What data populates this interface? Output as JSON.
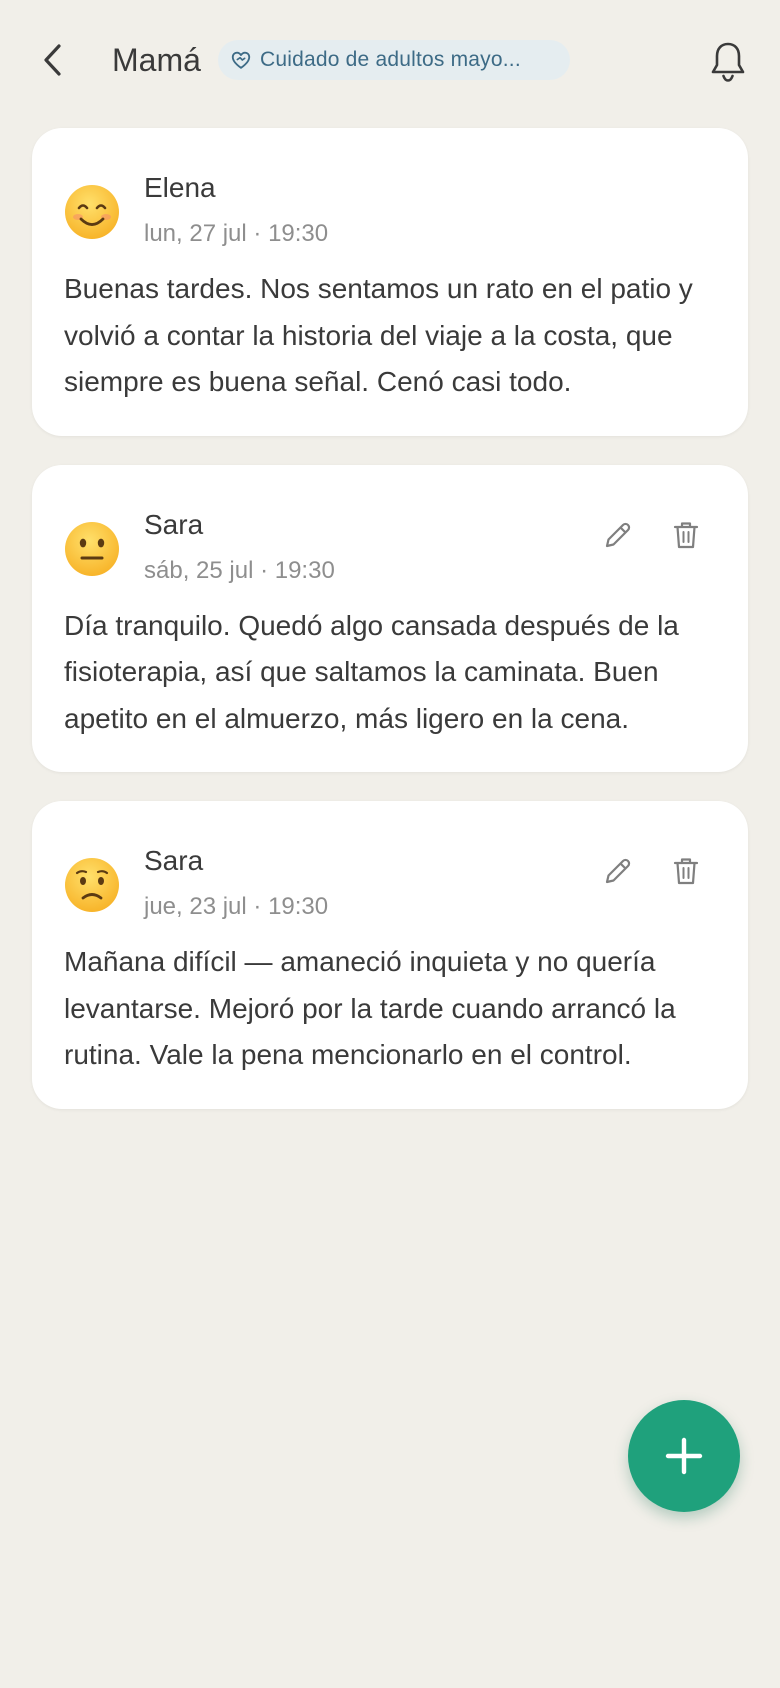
{
  "header": {
    "title": "Mamá",
    "badge": "Cuidado de adultos mayo...",
    "back_icon": "chevron-left-icon",
    "badge_icon": "heart-handshake-icon",
    "bell_icon": "bell-icon"
  },
  "entries": [
    {
      "author": "Elena",
      "when": "lun, 27 jul · 19:30",
      "mood": "smiling",
      "text": "Buenas tardes. Nos sentamos un rato en el patio y volvió a contar la historia del viaje a la costa, que siempre es buena señal. Cenó casi todo.",
      "editable": false
    },
    {
      "author": "Sara",
      "when": "sáb, 25 jul · 19:30",
      "mood": "neutral",
      "text": "Día tranquilo. Quedó algo cansada después de la fisioterapia, así que saltamos la caminata. Buen apetito en el almuerzo, más ligero en la cena.",
      "editable": true
    },
    {
      "author": "Sara",
      "when": "jue, 23 jul · 19:30",
      "mood": "worried",
      "text": "Mañana difícil — amaneció inquieta y no quería levantarse. Mejoró por la tarde cuando arrancó la rutina. Vale la pena mencionarlo en el control.",
      "editable": true
    }
  ],
  "fab": {
    "icon": "plus-icon"
  },
  "colors": {
    "background": "#f1efe9",
    "accent": "#1fa17c",
    "badge_bg": "#e5edf0",
    "badge_text": "#3d6b86"
  }
}
